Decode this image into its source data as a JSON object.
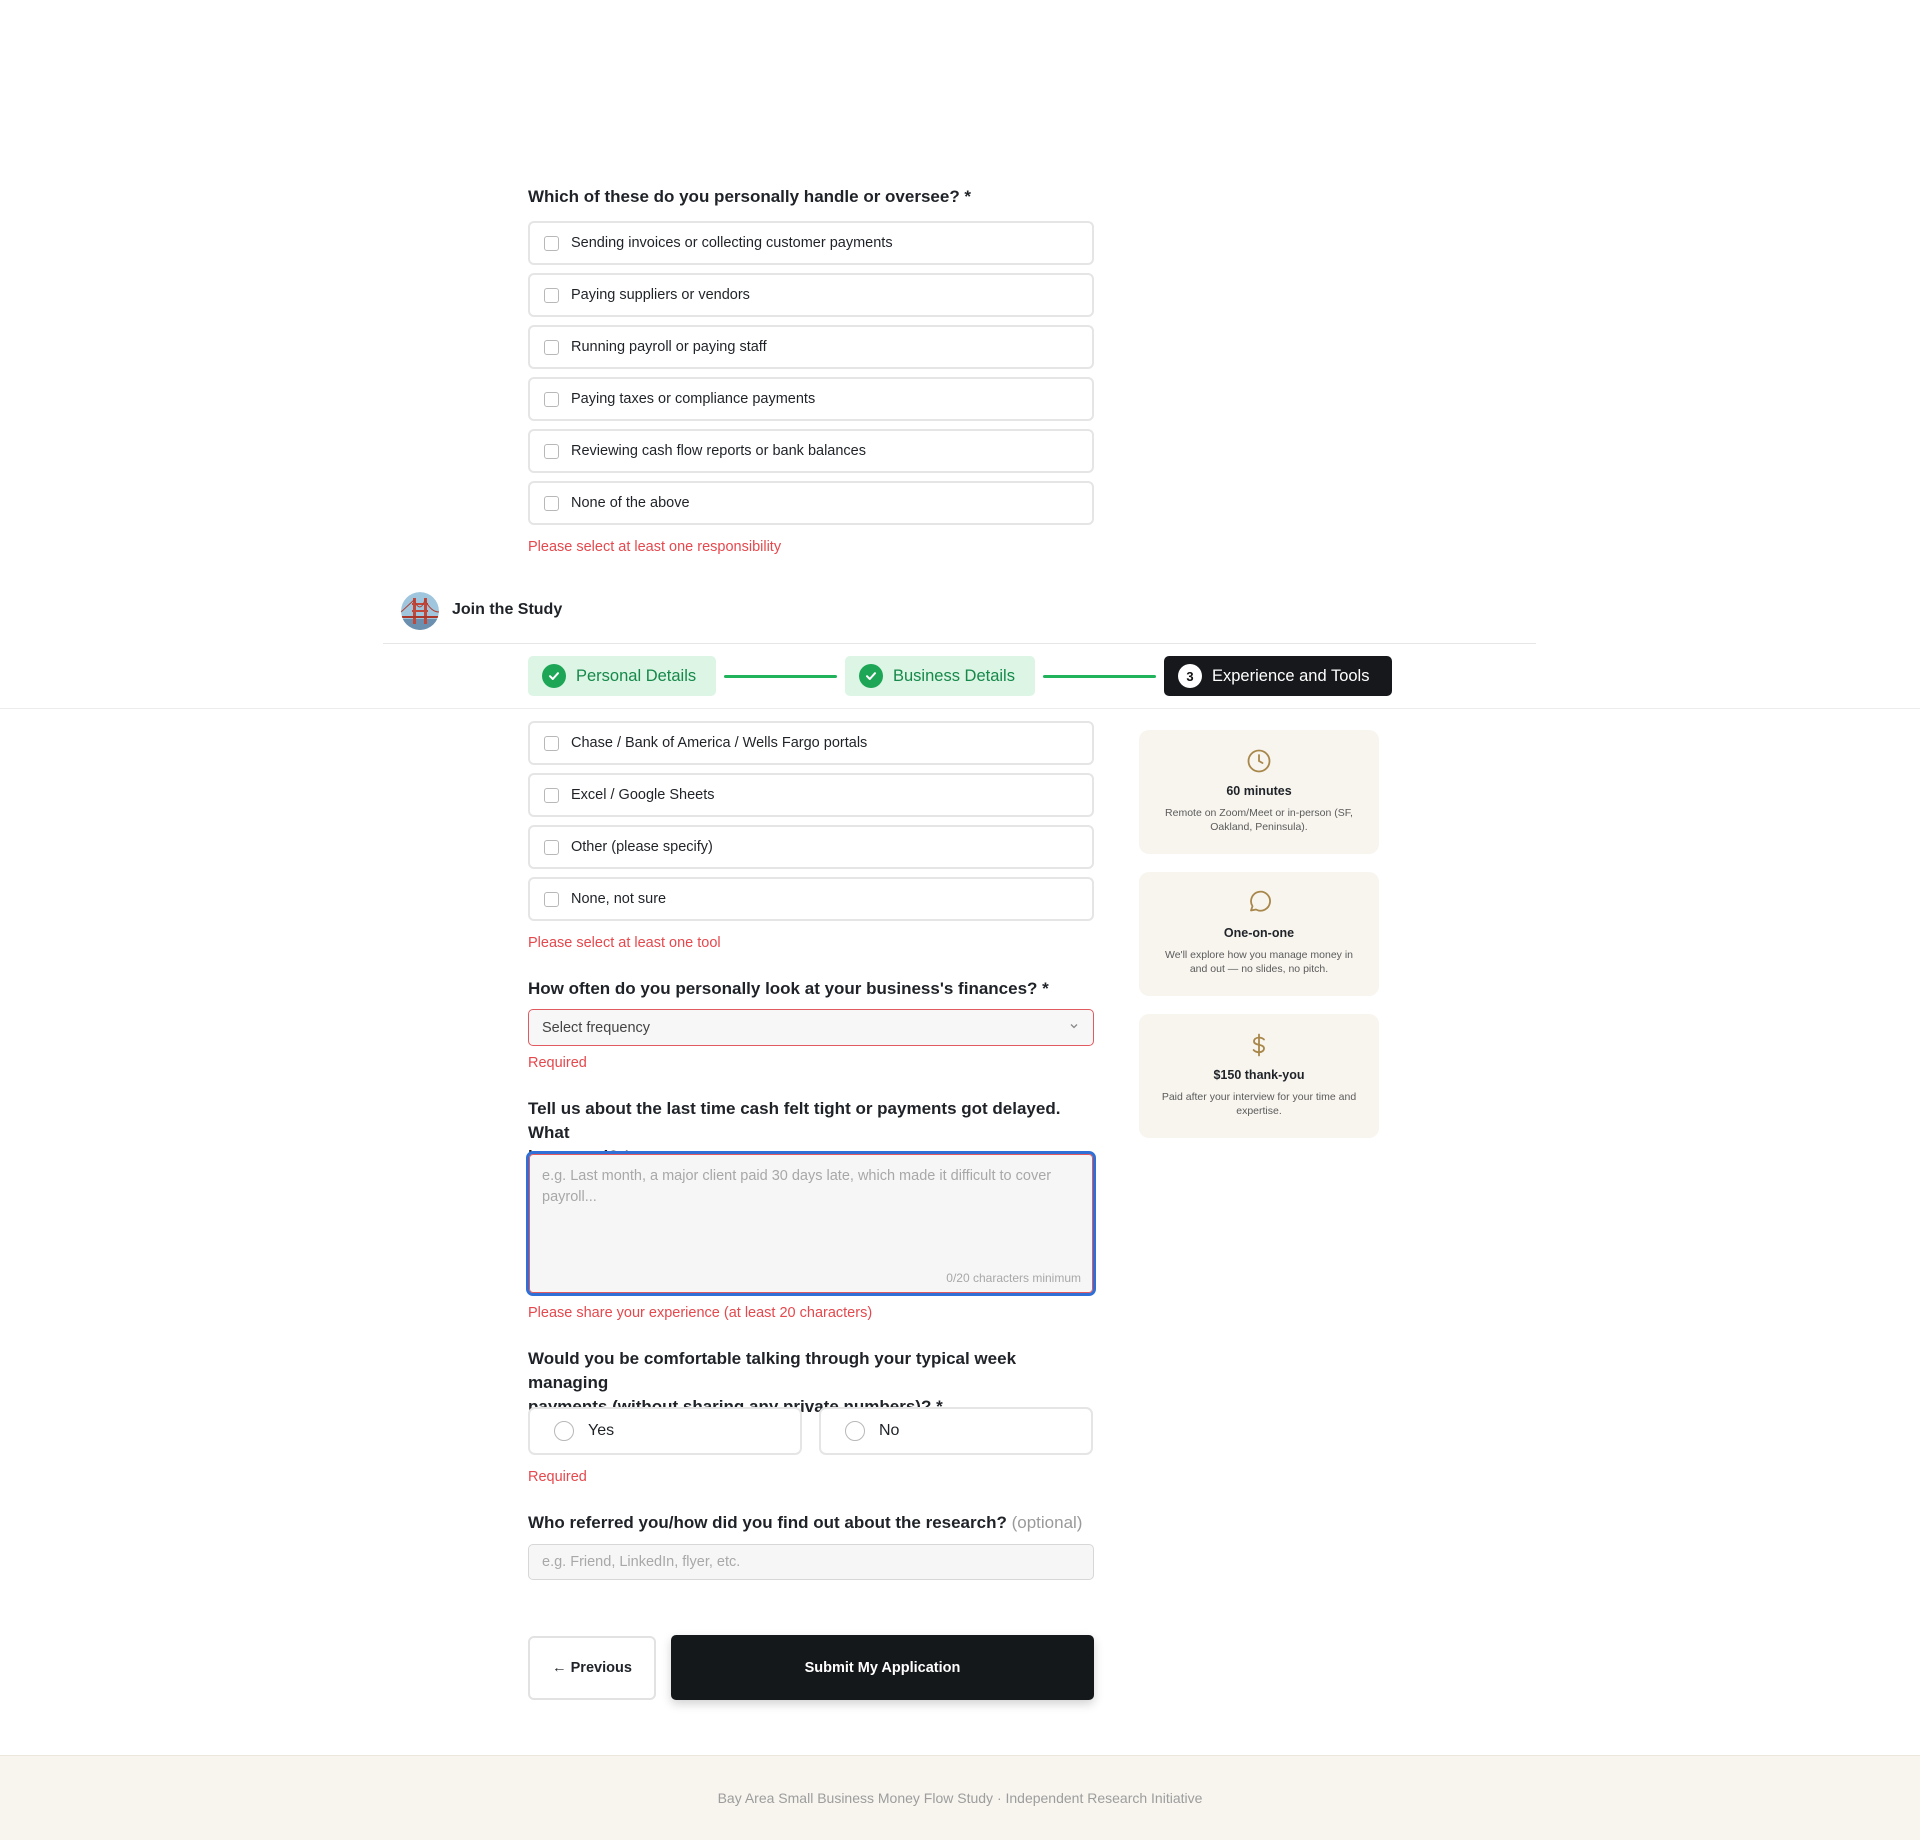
{
  "q1": {
    "label": "Which of these do you personally handle or oversee? *",
    "options": [
      "Sending invoices or collecting customer payments",
      "Paying suppliers or vendors",
      "Running payroll or paying staff",
      "Paying taxes or compliance payments",
      "Reviewing cash flow reports or bank balances",
      "None of the above"
    ],
    "error": "Please select at least one responsibility"
  },
  "q2": {
    "options": [
      "Chase / Bank of America / Wells Fargo portals",
      "Excel / Google Sheets",
      "Other (please specify)",
      "None, not sure"
    ],
    "error": "Please select at least one tool"
  },
  "q3": {
    "label": "How often do you personally look at your business's finances? *",
    "select_value": "Select frequency",
    "error": "Required"
  },
  "q4": {
    "label_line1": "Tell us about the last time cash felt tight or payments got delayed. What",
    "label_line2": "happened? *",
    "placeholder": "e.g. Last month, a major client paid 30 days late, which made it difficult to cover payroll...",
    "counter": "0/20 characters minimum",
    "error": "Please share your experience (at least 20 characters)"
  },
  "q5": {
    "label_line1": "Would you be comfortable talking through your typical week managing",
    "label_line2": "payments (without sharing any private numbers)? *",
    "options": [
      "Yes",
      "No"
    ],
    "error": "Required"
  },
  "q6": {
    "label": "Who referred you/how did you find out about the research?",
    "optional": "(optional)",
    "placeholder": "e.g. Friend, LinkedIn, flyer, etc."
  },
  "buttons": {
    "previous": "← Previous",
    "submit": "Submit My Application"
  },
  "header": {
    "brand": "Join the Study",
    "steps": [
      {
        "label": "Personal Details",
        "status": "done"
      },
      {
        "label": "Business Details",
        "status": "done"
      },
      {
        "number": "3",
        "label": "Experience and Tools",
        "status": "active"
      }
    ]
  },
  "cards": [
    {
      "icon": "clock-icon",
      "title": "60 minutes",
      "desc": "Remote on Zoom/Meet or in-person (SF, Oakland, Peninsula)."
    },
    {
      "icon": "chat-bubble-icon",
      "title": "One-on-one",
      "desc": "We'll explore how you manage money in and out — no slides, no pitch."
    },
    {
      "icon": "dollar-icon",
      "title": "$150 thank-you",
      "desc": "Paid after your interview for your time and expertise."
    }
  ],
  "footer": "Bay Area Small Business Money Flow Study · Independent Research Initiative",
  "colors": {
    "accent_green": "#1ea657",
    "error_red": "#e5484d",
    "focus_blue": "#2f6fd6",
    "dark_button": "#15181b",
    "card_bg": "#f8f5ef",
    "icon_gold": "#a8874a"
  }
}
